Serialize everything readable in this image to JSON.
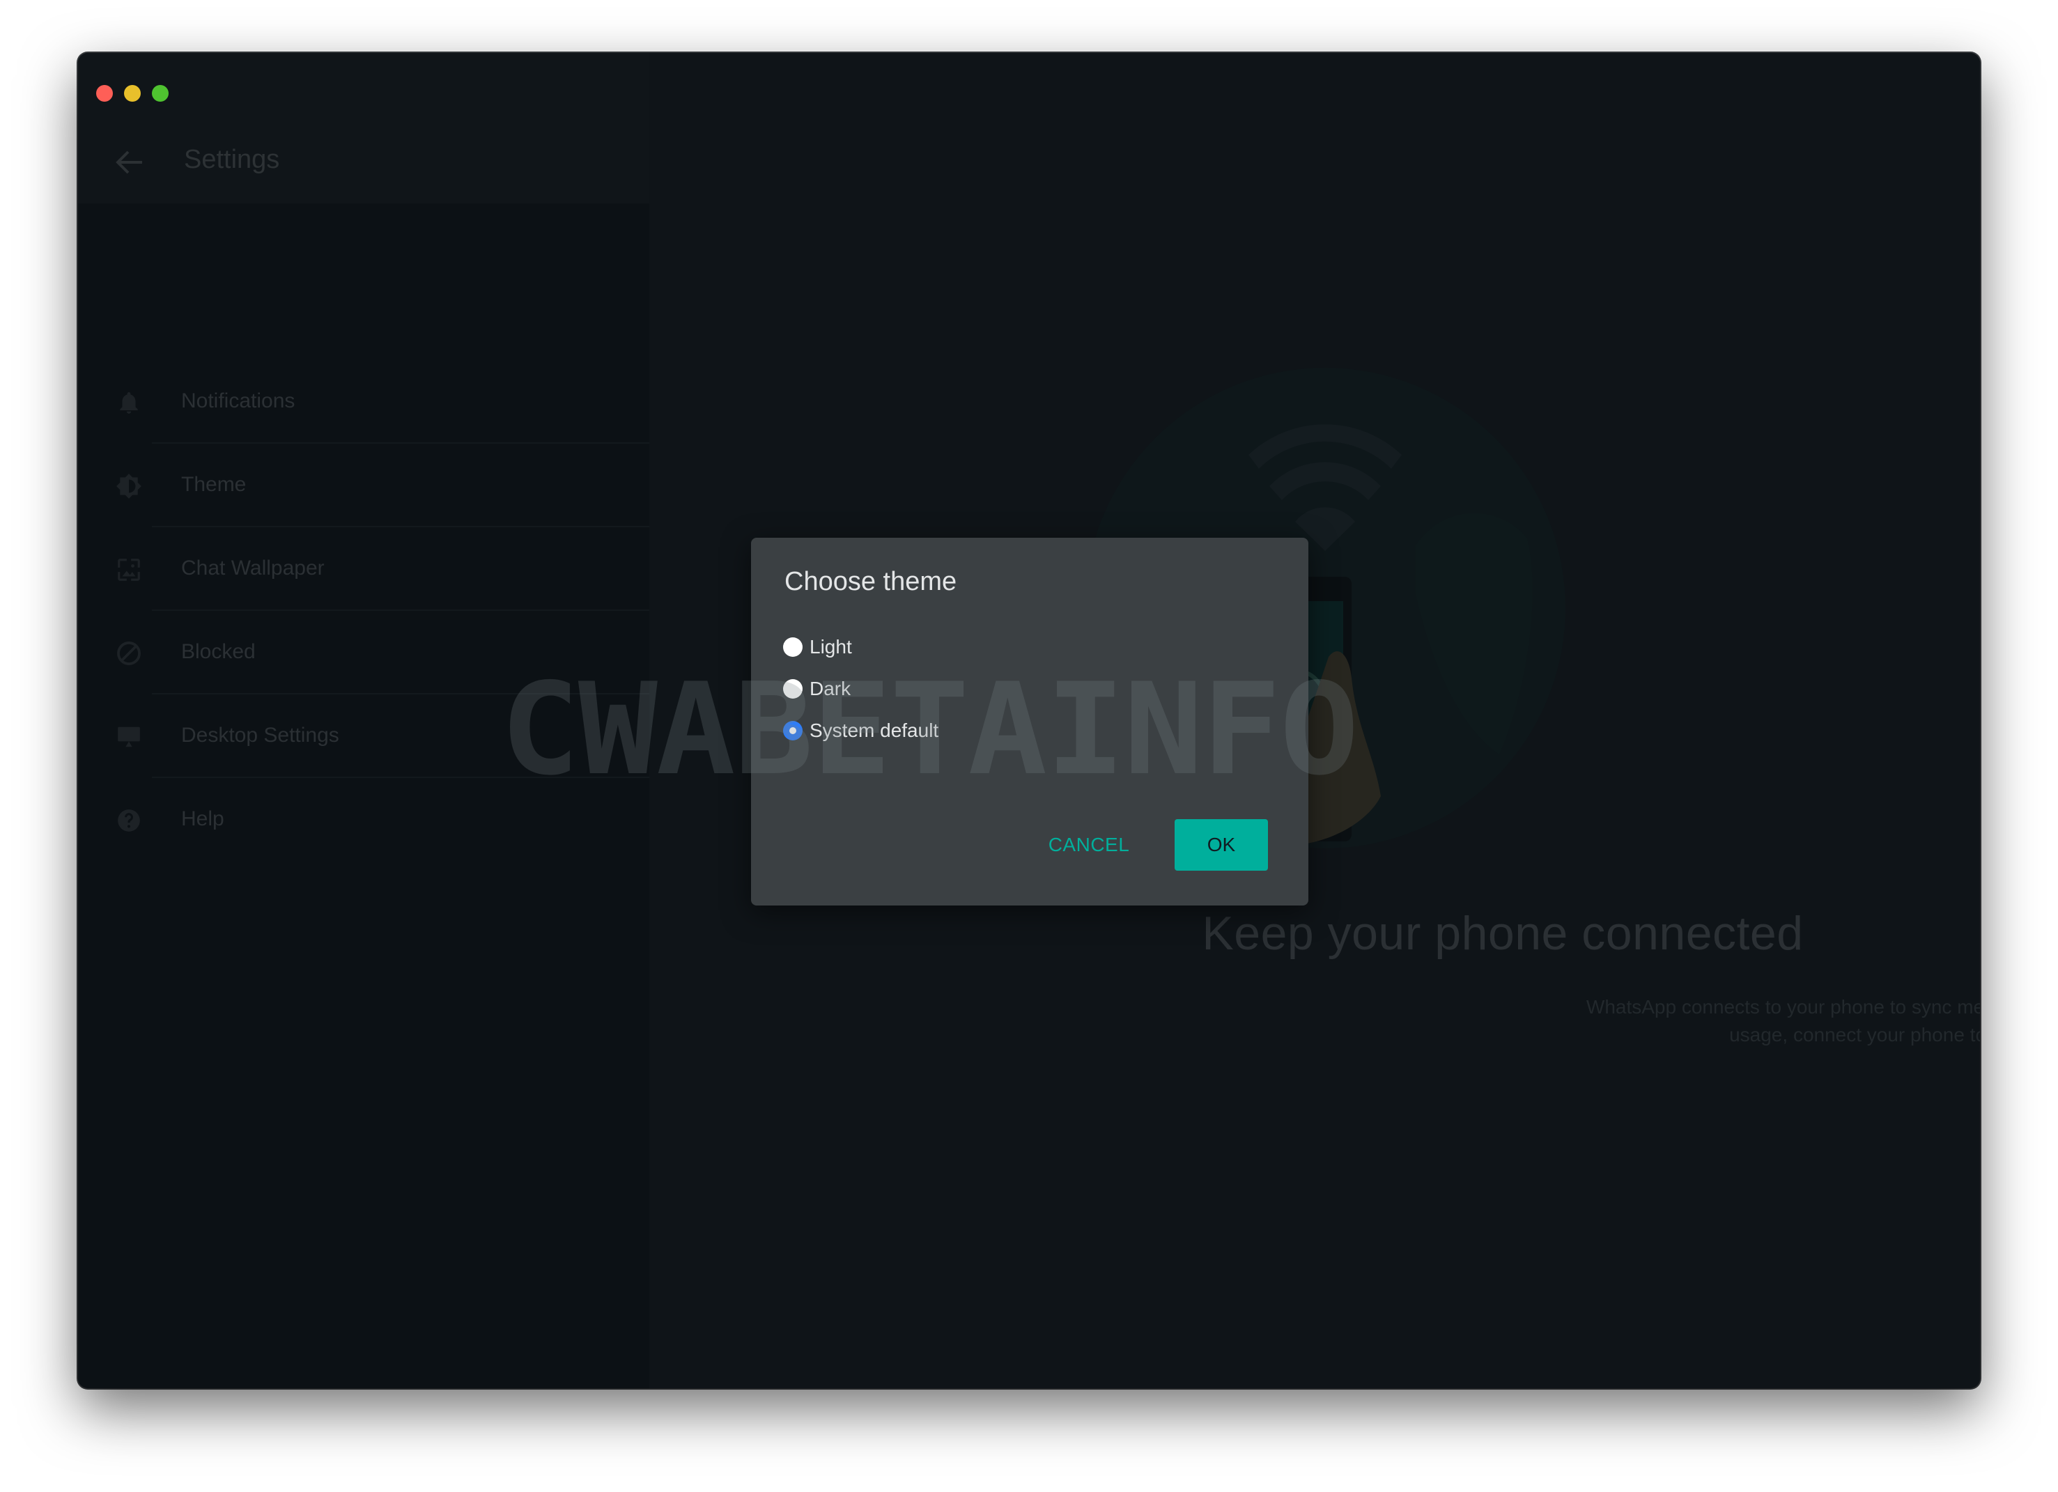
{
  "window": {
    "traffic_lights": [
      "close",
      "minimize",
      "maximize"
    ]
  },
  "sidebar": {
    "header_title": "Settings",
    "back_icon": "arrow-left-icon",
    "items": [
      {
        "label": "Notifications",
        "icon": "bell-icon"
      },
      {
        "label": "Theme",
        "icon": "theme-brightness-icon"
      },
      {
        "label": "Chat Wallpaper",
        "icon": "wallpaper-icon"
      },
      {
        "label": "Blocked",
        "icon": "blocked-icon"
      },
      {
        "label": "Desktop Settings",
        "icon": "desktop-icon"
      },
      {
        "label": "Help",
        "icon": "help-icon"
      }
    ]
  },
  "main": {
    "title": "Keep your phone connected",
    "subtitle": "WhatsApp connects to your phone to sync messages. To reduce data usage, connect your phone to Wi-Fi."
  },
  "dialog": {
    "title": "Choose theme",
    "options": [
      {
        "label": "Light",
        "checked": false
      },
      {
        "label": "Dark",
        "checked": false
      },
      {
        "label": "System default",
        "checked": true
      }
    ],
    "cancel_label": "CANCEL",
    "ok_label": "OK"
  },
  "watermark": "CWABETAINFO",
  "colors": {
    "accent": "#00af9c",
    "radio_selected": "#2f7df6",
    "dialog_bg": "#3b4043",
    "app_bg": "#0f1418"
  }
}
